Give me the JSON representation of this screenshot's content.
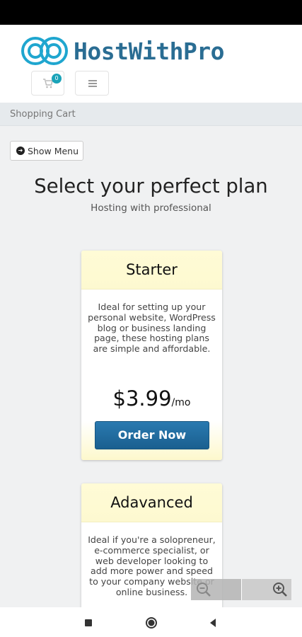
{
  "brand": {
    "name": "HostWithPro",
    "color": "#2a6d93"
  },
  "header": {
    "cart_count": "0"
  },
  "breadcrumb": "Shopping Cart",
  "show_menu_label": "Show Menu",
  "title": "Select your perfect plan",
  "subtitle": "Hosting with professional",
  "plans": [
    {
      "name": "Starter",
      "description": "Ideal for setting up your personal website, WordPress blog or business landing page, these hosting plans are simple and affordable.",
      "price": "$3.99",
      "period": "/mo",
      "order_label": "Order Now"
    },
    {
      "name": "Adavanced",
      "description": "Ideal if you're a solopreneur, e-commerce specialist, or web developer looking to add more power and speed to your company website or online business."
    }
  ],
  "icons": {
    "logo": "infinity-rings-logo",
    "cart": "shopping-cart-icon",
    "menu": "hamburger-menu-icon",
    "show_menu": "arrow-circle-right-icon",
    "zoom_out": "zoom-out-icon",
    "zoom_in": "zoom-in-icon",
    "nav_recents": "square-icon",
    "nav_home": "circle-icon",
    "nav_back": "triangle-back-icon"
  }
}
